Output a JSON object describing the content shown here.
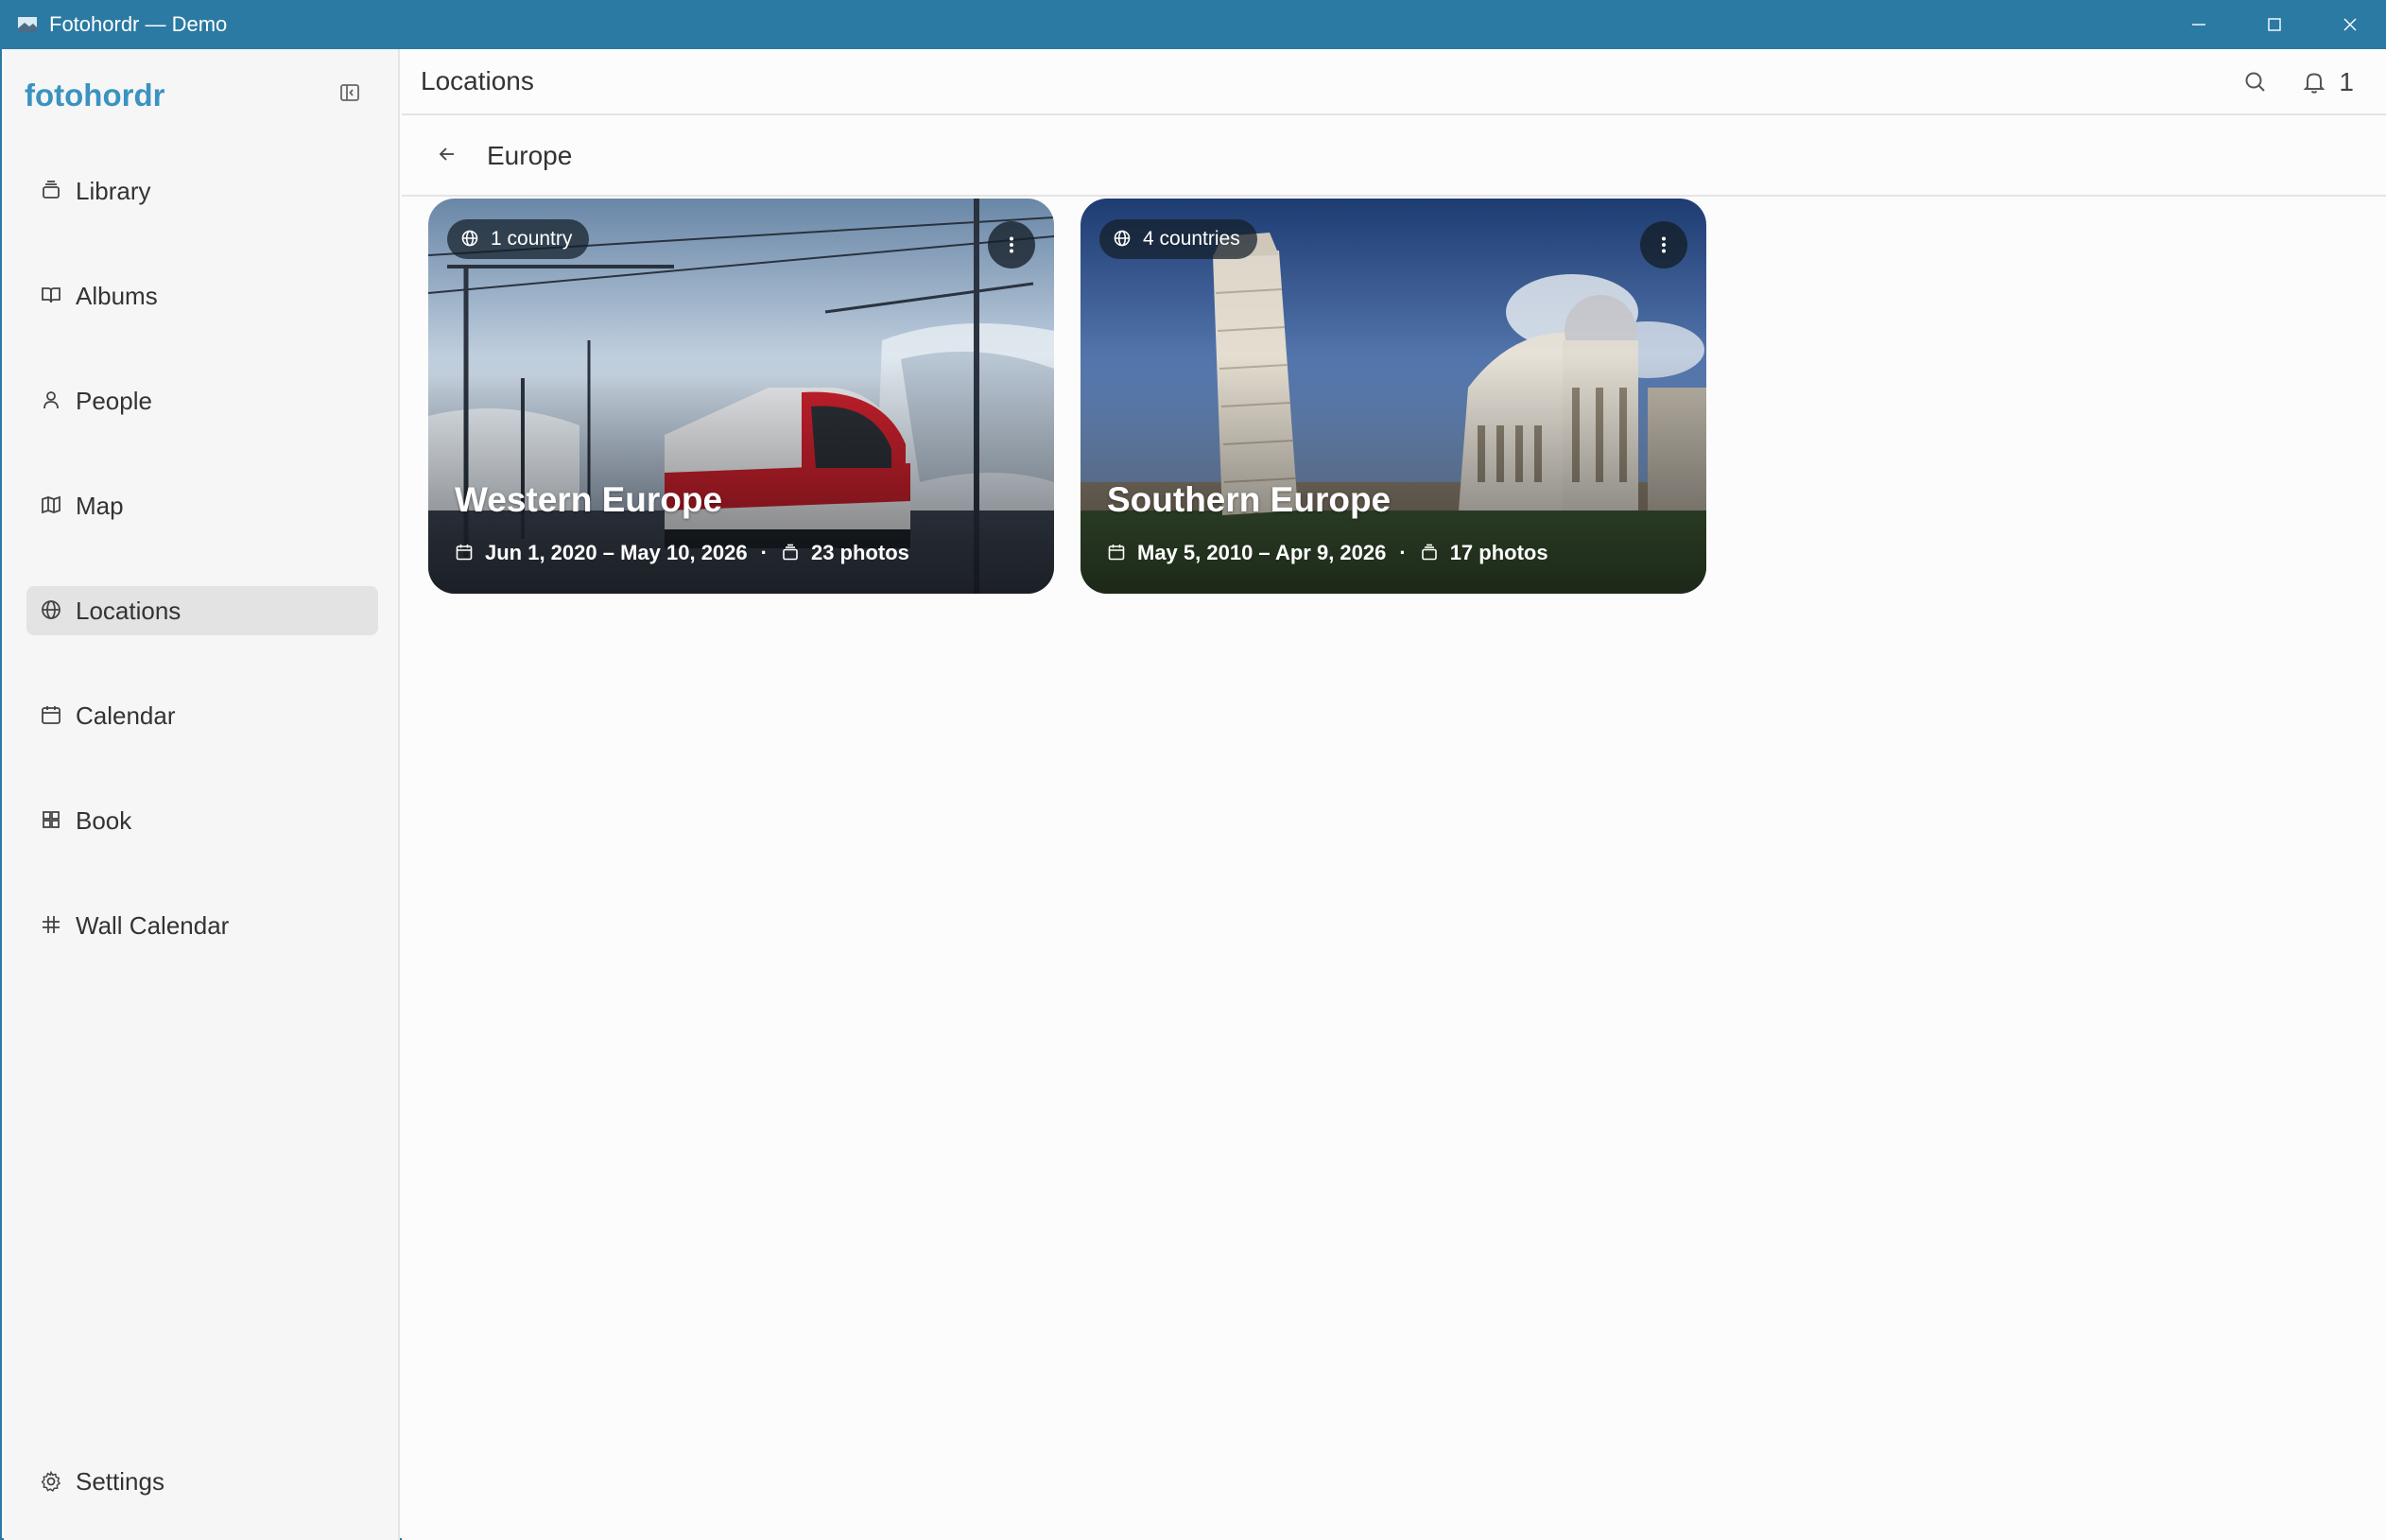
{
  "window": {
    "title": "Fotohordr — Demo",
    "accent": "#2a7aa3"
  },
  "sidebar": {
    "brand": "fotohordr",
    "brand_color": "#3a93c0",
    "items": [
      {
        "label": "Library",
        "icon": "library-icon"
      },
      {
        "label": "Albums",
        "icon": "book-open-icon"
      },
      {
        "label": "People",
        "icon": "person-icon"
      },
      {
        "label": "Map",
        "icon": "map-icon"
      },
      {
        "label": "Locations",
        "icon": "globe-icon",
        "active": true
      },
      {
        "label": "Calendar",
        "icon": "calendar-icon"
      },
      {
        "label": "Book",
        "icon": "grid-icon"
      },
      {
        "label": "Wall Calendar",
        "icon": "hash-icon"
      }
    ],
    "settings_label": "Settings"
  },
  "header": {
    "title": "Locations",
    "notification_count": "1"
  },
  "subheader": {
    "breadcrumb": "Europe"
  },
  "cards": [
    {
      "chip": "1 country",
      "title": "Western Europe",
      "dates": "Jun 1, 2020 – May 10, 2026",
      "photos": "23 photos"
    },
    {
      "chip": "4 countries",
      "title": "Southern Europe",
      "dates": "May 5, 2010 – Apr 9, 2026",
      "photos": "17 photos"
    }
  ]
}
